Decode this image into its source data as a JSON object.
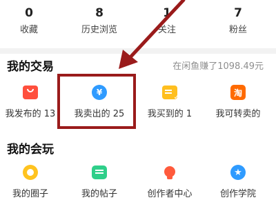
{
  "stats": [
    {
      "value": "0",
      "label": "收藏"
    },
    {
      "value": "8",
      "label": "历史浏览"
    },
    {
      "value": "1",
      "label": "关注"
    },
    {
      "value": "7",
      "label": "粉丝"
    }
  ],
  "trade": {
    "title": "我的交易",
    "earned": "在闲鱼赚了1098.49元",
    "items": [
      {
        "label": "我发布的 13",
        "icon": "shopping-bag-icon",
        "color": "#ff4f3d"
      },
      {
        "label": "我卖出的 25",
        "icon": "yen-coin-icon",
        "color": "#2f9bff"
      },
      {
        "label": "我买到的 1",
        "icon": "order-check-icon",
        "color": "#ffbf1f"
      },
      {
        "label": "我可转卖的",
        "icon": "tao-icon",
        "glyph": "淘",
        "color": "#ff6a00"
      }
    ]
  },
  "play": {
    "title": "我的会玩",
    "items": [
      {
        "label": "我的圈子",
        "icon": "circle-icon",
        "color": "#ffc31f"
      },
      {
        "label": "我的帖子",
        "icon": "post-icon",
        "color": "#2fcf8a"
      },
      {
        "label": "创作者中心",
        "icon": "lightbulb-icon",
        "color": "#ff5a3c"
      },
      {
        "label": "创作学院",
        "icon": "star-icon",
        "color": "#2f9bff"
      }
    ]
  },
  "annotation": {
    "color": "#9a1b1b"
  },
  "yen_glyph": "¥",
  "star_glyph": "★"
}
